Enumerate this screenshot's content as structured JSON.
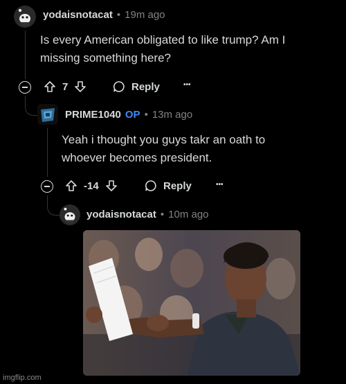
{
  "comments": [
    {
      "username": "yodaisnotacat",
      "time": "19m ago",
      "body_line1": "Is every American obligated to like trump? Am I",
      "body_line2": "missing something here?",
      "votes": "7",
      "reply_label": "Reply",
      "more_label": "•••"
    },
    {
      "username": "PRIME1040",
      "op_badge": "OP",
      "time": "13m ago",
      "body_line1": "Yeah i thought you guys takr an oath to",
      "body_line2": "whoever becomes president.",
      "votes": "-14",
      "reply_label": "Reply",
      "more_label": "•••"
    },
    {
      "username": "yodaisnotacat",
      "time": "10m ago"
    }
  ],
  "separator": "•",
  "watermark": "imgflip.com",
  "colors": {
    "background": "#000000",
    "text": "#d7dadc",
    "muted": "#818384",
    "op": "#3d8af7"
  }
}
